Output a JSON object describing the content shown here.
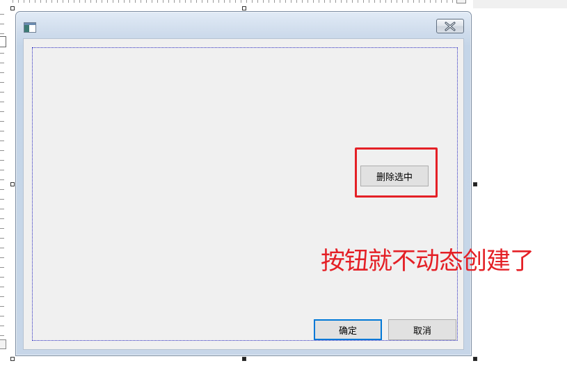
{
  "dialog": {
    "title": "",
    "close_icon": "close-icon",
    "app_icon": "dialog-app-icon",
    "buttons": {
      "delete_selected": "删除选中",
      "ok": "确定",
      "cancel": "取消"
    }
  },
  "annotation": {
    "text": "按钮就不动态创建了",
    "color": "#e42026"
  },
  "colors": {
    "focus_border": "#0078d7",
    "dotted_frame": "#2a2ac0"
  }
}
